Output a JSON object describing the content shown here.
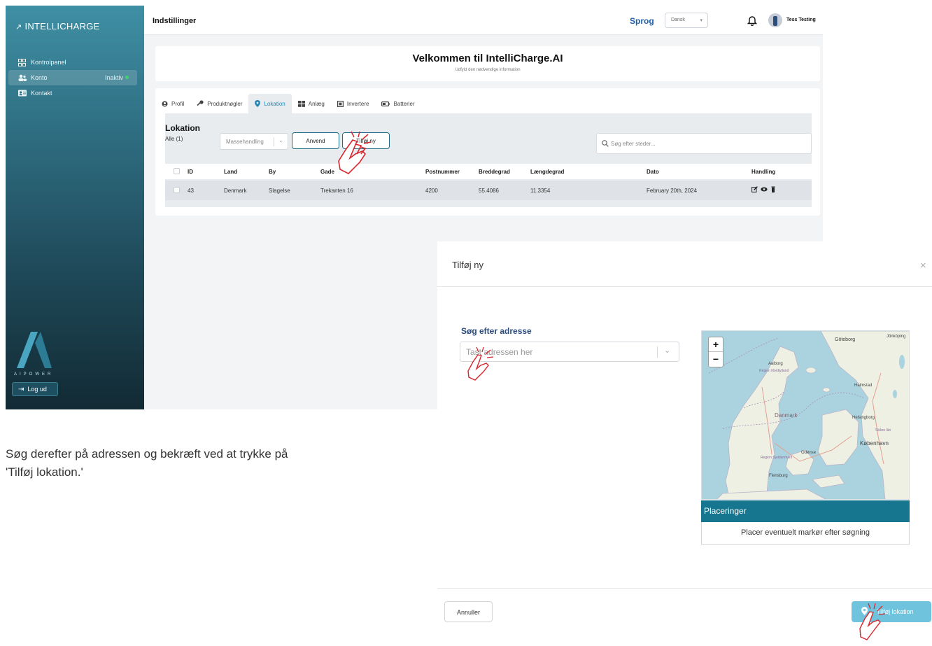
{
  "sidebar": {
    "brand": "INTELLICHARGE",
    "items": [
      {
        "label": "Kontrolpanel"
      },
      {
        "label": "Konto",
        "badge": "Inaktiv"
      },
      {
        "label": "Kontakt"
      }
    ],
    "logo_text": "AIPOWER",
    "logout_label": "Log ud"
  },
  "topbar": {
    "title": "Indstillinger",
    "language_label": "Sprog",
    "language_value": "Dansk",
    "user_name": "Tess Testing"
  },
  "welcome": {
    "title": "Velkommen til IntelliCharge.AI",
    "subtitle": "Udfyld den nødvendige information"
  },
  "tabs": [
    {
      "label": "Profil"
    },
    {
      "label": "Produktnøgler"
    },
    {
      "label": "Lokation",
      "active": true
    },
    {
      "label": "Anlæg"
    },
    {
      "label": "Invertere"
    },
    {
      "label": "Batterier"
    }
  ],
  "location": {
    "title": "Lokation",
    "filter_label": "Alle",
    "filter_count": "(1)",
    "bulk_placeholder": "Massehandling",
    "apply_label": "Anvend",
    "add_label": "Tilføj ny",
    "search_placeholder": "Søg efter steder...",
    "columns": [
      "ID",
      "Land",
      "By",
      "Gade",
      "Postnummer",
      "Breddegrad",
      "Længdegrad",
      "Dato",
      "Handling"
    ],
    "rows": [
      {
        "id": "43",
        "land": "Denmark",
        "by": "Slagelse",
        "gade": "Trekanten 16",
        "postnummer": "4200",
        "breddegrad": "55.4086",
        "laengdegrad": "11.3354",
        "dato": "February 20th, 2024"
      }
    ]
  },
  "modal": {
    "title": "Tilføj ny",
    "close": "×",
    "search_label": "Søg efter adresse",
    "search_placeholder": "Tast adressen her",
    "zoom_in": "+",
    "zoom_out": "−",
    "map_labels": {
      "goteborg": "Göteborg",
      "jonkoping": "Jönköping",
      "aalborg": "Aalborg",
      "nordjylland": "Region Nordjylland",
      "halmstad": "Halmstad",
      "danmark": "Danmark",
      "helsingborg": "Helsingborg",
      "skane": "Skåne län",
      "kobenhavn": "København",
      "odense": "Odense",
      "syddanmark": "Region Syddanmark",
      "flensburg": "Flensburg"
    },
    "places_header": "Placeringer",
    "places_body": "Placer eventuelt markør efter søgning",
    "cancel_label": "Annuller",
    "add_location_label": "Tilføj lokation"
  },
  "caption": "Søg derefter på adressen og bekræft ved at trykke på 'Tilføj lokation.'",
  "colors": {
    "accent": "#16768f",
    "link_blue": "#1f5fae",
    "cursor_red": "#d9262c"
  }
}
